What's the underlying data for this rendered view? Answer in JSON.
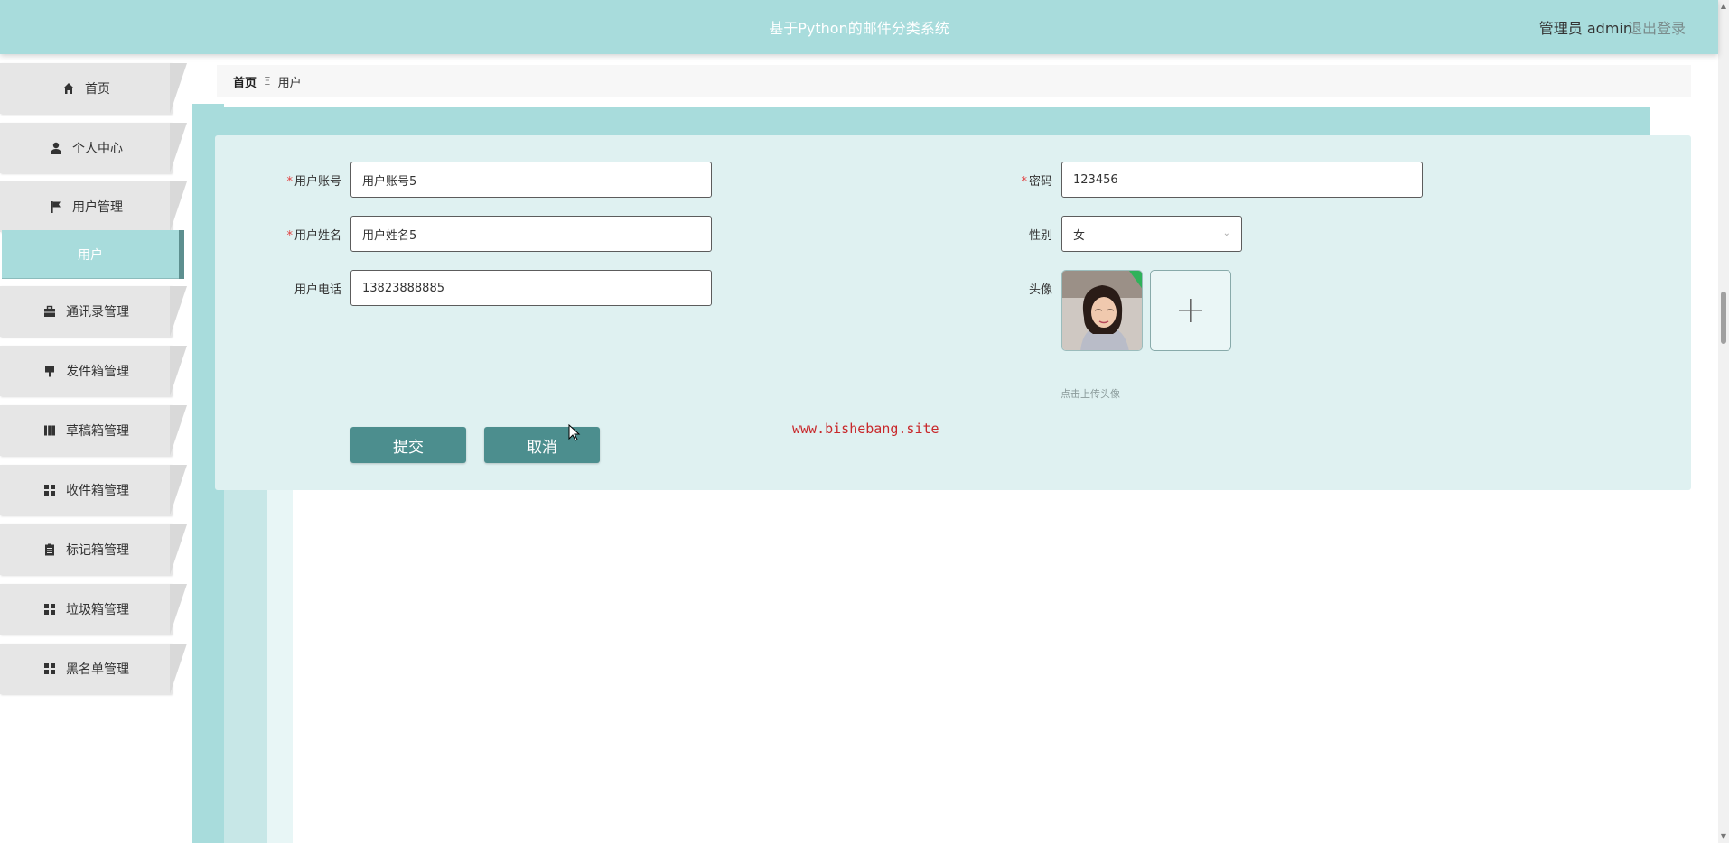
{
  "header": {
    "title": "基于Python的邮件分类系统",
    "user": "管理员 admin",
    "logout": "退出登录"
  },
  "sidebar": {
    "items": [
      {
        "label": "首页",
        "icon": "home-icon"
      },
      {
        "label": "个人中心",
        "icon": "person-icon"
      },
      {
        "label": "用户管理",
        "icon": "flag-icon"
      },
      {
        "label": "通讯录管理",
        "icon": "briefcase-icon"
      },
      {
        "label": "发件箱管理",
        "icon": "brush-icon"
      },
      {
        "label": "草稿箱管理",
        "icon": "book-icon"
      },
      {
        "label": "收件箱管理",
        "icon": "grid-icon"
      },
      {
        "label": "标记箱管理",
        "icon": "clipboard-icon"
      },
      {
        "label": "垃圾箱管理",
        "icon": "grid-icon"
      },
      {
        "label": "黑名单管理",
        "icon": "grid-icon"
      }
    ],
    "sub_item": "用户"
  },
  "breadcrumb": {
    "home": "首页",
    "separator": "Ξ",
    "current": "用户"
  },
  "form": {
    "account": {
      "label": "用户账号",
      "value": "用户账号5",
      "required": true
    },
    "password": {
      "label": "密码",
      "value": "123456",
      "required": true
    },
    "name": {
      "label": "用户姓名",
      "value": "用户姓名5",
      "required": true
    },
    "gender": {
      "label": "性别",
      "value": "女"
    },
    "phone": {
      "label": "用户电话",
      "value": "13823888885"
    },
    "avatar": {
      "label": "头像",
      "hint": "点击上传头像"
    },
    "submit_label": "提交",
    "cancel_label": "取消",
    "required_mark": "*"
  },
  "watermark": "www.bishebang.site",
  "colors": {
    "accent": "#a8dcdc",
    "button": "#4c8e8e",
    "panel": "#dff1f1",
    "required": "#e04040"
  }
}
